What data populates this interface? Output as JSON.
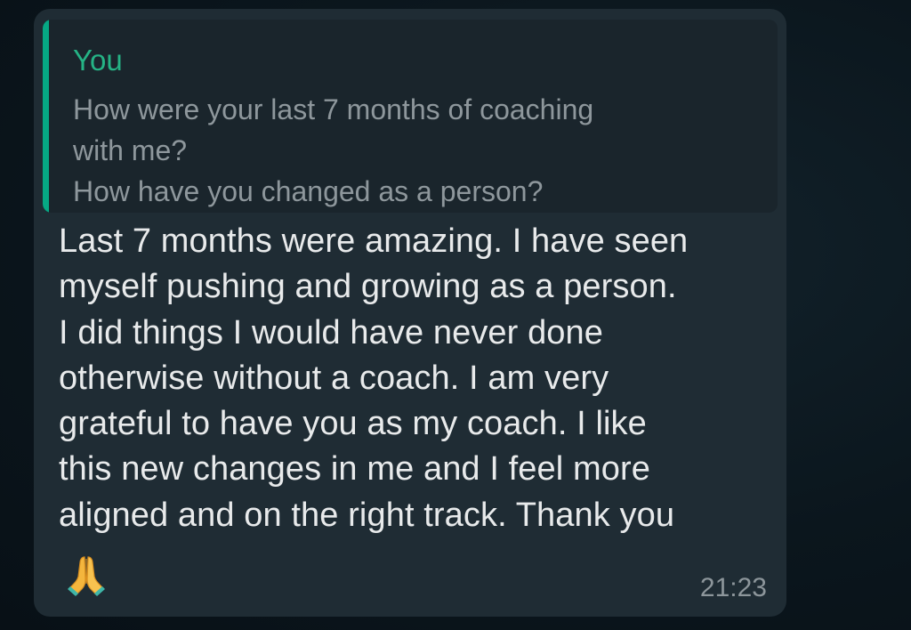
{
  "quoted_message": {
    "author": "You",
    "text": "How were your last 7 months of coaching\nwith me?\nHow have you changed as a person?"
  },
  "message": {
    "text": "Last 7 months were amazing. I have seen\nmyself pushing and growing as a person.\nI did things I would have never done\notherwise without a coach. I am very\ngrateful to have you as my coach. I like\nthis new changes in me and I feel more\naligned and on the right track. Thank you",
    "emoji": "folded-hands-icon",
    "time": "21:23"
  },
  "colors": {
    "background": "#0b141a",
    "bubble": "#1f2c34",
    "quote_bar": "#06a884",
    "author": "#25b385",
    "message_text": "#e8eaeb",
    "muted_text": "#8e979c"
  }
}
